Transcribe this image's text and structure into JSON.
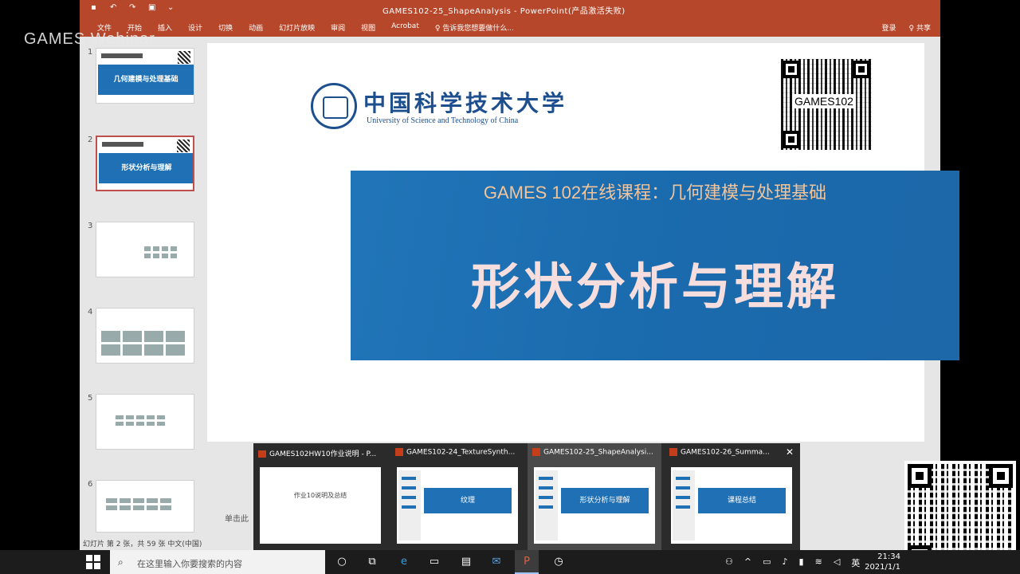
{
  "watermark": {
    "text": "GAMES Webinar"
  },
  "window": {
    "title": "GAMES102-25_ShapeAnalysis - PowerPoint(产品激活失败)",
    "ribbon_tabs": [
      "文件",
      "开始",
      "插入",
      "设计",
      "切换",
      "动画",
      "幻灯片放映",
      "审阅",
      "视图",
      "Acrobat",
      "♀ 告诉我您想要做什么..."
    ],
    "ribbon_right": [
      "登录",
      "♀ 共享"
    ]
  },
  "thumbnails": [
    {
      "num": "1",
      "banner": "几何建模与处理基础"
    },
    {
      "num": "2",
      "banner": "形状分析与理解"
    },
    {
      "num": "3"
    },
    {
      "num": "4"
    },
    {
      "num": "5"
    },
    {
      "num": "6"
    }
  ],
  "slide": {
    "university_cn": "中国科学技术大学",
    "university_en": "University of Science and Technology of China",
    "qr_label": "GAMES102",
    "course_line": "GAMES 102在线课程：几何建模与处理基础",
    "topic": "形状分析与理解"
  },
  "statusbar": {
    "text": "幻灯片 第 2 张，共 59 张    中文(中国)"
  },
  "notes": {
    "text": "单击此"
  },
  "previews": [
    {
      "title": "GAMES102HW10作业说明 - P...",
      "content": "作业10说明及总结"
    },
    {
      "title": "GAMES102-24_TextureSynth...",
      "content": "纹理"
    },
    {
      "title": "GAMES102-25_ShapeAnalysi...",
      "content": "形状分析与理解"
    },
    {
      "title": "GAMES102-26_Summa...",
      "content": "课程总结"
    }
  ],
  "taskbar": {
    "search_placeholder": "在这里输入你要搜索的内容",
    "ime": "英",
    "time": "21:34",
    "date": "2021/1/1"
  }
}
